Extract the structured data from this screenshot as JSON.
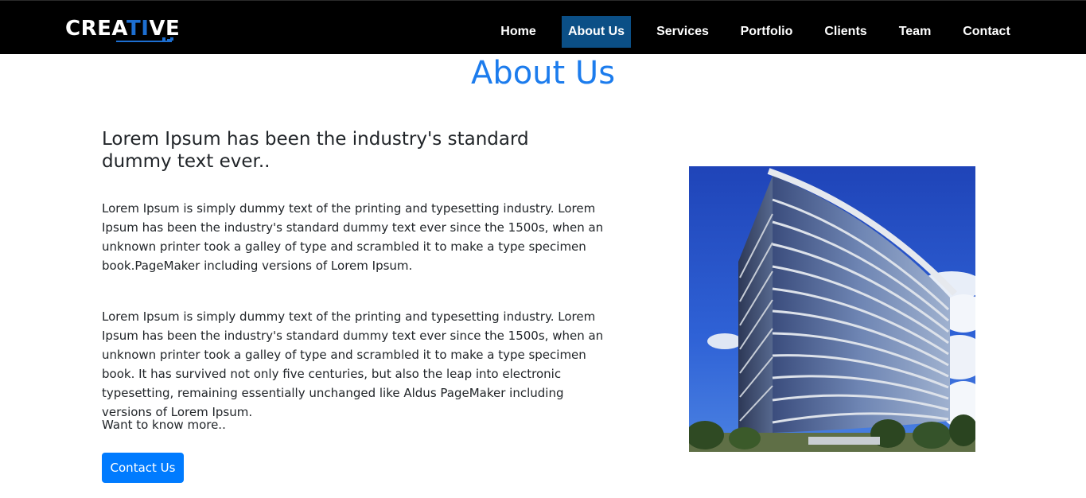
{
  "brand": {
    "logo_text_start": "CREA",
    "logo_text_accent": "TI",
    "logo_text_end": "VE",
    "accent_color": "#1d6fd1"
  },
  "nav": {
    "items": [
      {
        "label": "Home",
        "active": false
      },
      {
        "label": "About Us",
        "active": true
      },
      {
        "label": "Services",
        "active": false
      },
      {
        "label": "Portfolio",
        "active": false
      },
      {
        "label": "Clients",
        "active": false
      },
      {
        "label": "Team",
        "active": false
      },
      {
        "label": "Contact",
        "active": false
      }
    ],
    "active_color": "#0b4f86"
  },
  "main": {
    "title": "About Us",
    "heading": "Lorem Ipsum has been the industry's standard dummy text ever..",
    "paragraph_1": "Lorem Ipsum is simply dummy text of the printing and typesetting industry. Lorem Ipsum has been the industry's standard dummy text ever since the 1500s, when an unknown printer took a galley of type and scrambled it to make a type specimen book.PageMaker including versions of Lorem Ipsum.",
    "paragraph_2": "Lorem Ipsum is simply dummy text of the printing and typesetting industry. Lorem Ipsum has been the industry's standard dummy text ever since the 1500s, when an unknown printer took a galley of type and scrambled it to make a type specimen book. It has survived not only five centuries, but also the leap into electronic typesetting, remaining essentially unchanged like Aldus PageMaker including versions of Lorem Ipsum.",
    "more_text": "Want to know more..",
    "contact_button": "Contact Us",
    "image_subject": "office-building-photo",
    "title_color": "#1c7ced",
    "button_color": "#007bff"
  }
}
